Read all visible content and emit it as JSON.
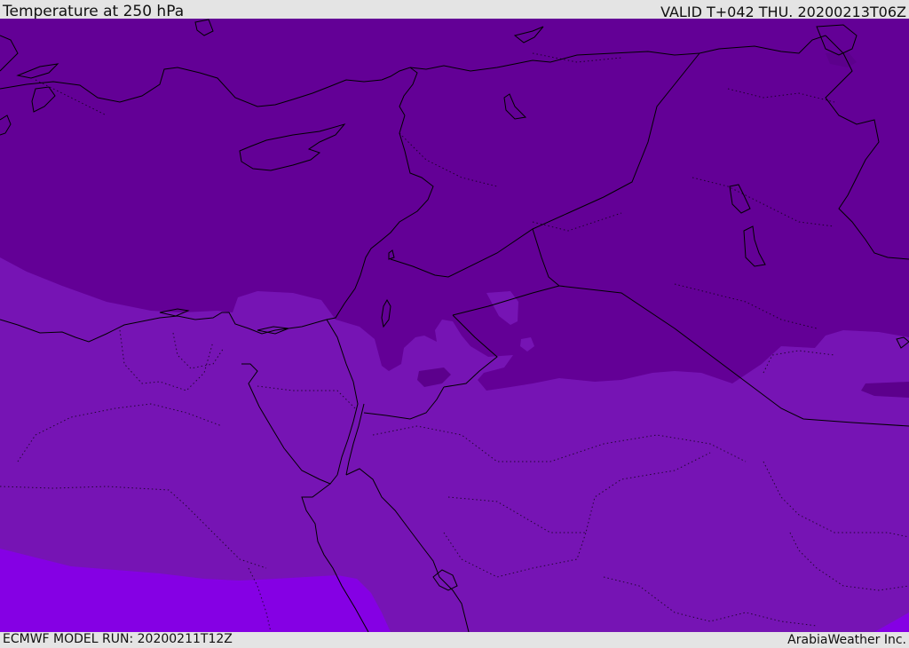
{
  "header": {
    "title": "Temperature at 250 hPa",
    "valid": "VALID T+042 THU. 20200213T06Z"
  },
  "footer": {
    "model_run": "ECMWF MODEL RUN: 20200211T12Z",
    "brand": "ArabiaWeather Inc."
  },
  "colors": {
    "coldest_band": "#630096",
    "cold_band": "#7614b4",
    "warm_band": "#8500e4",
    "patch_band": "#5c008c",
    "coastline": "#000000",
    "background": "#e4e4e4"
  }
}
